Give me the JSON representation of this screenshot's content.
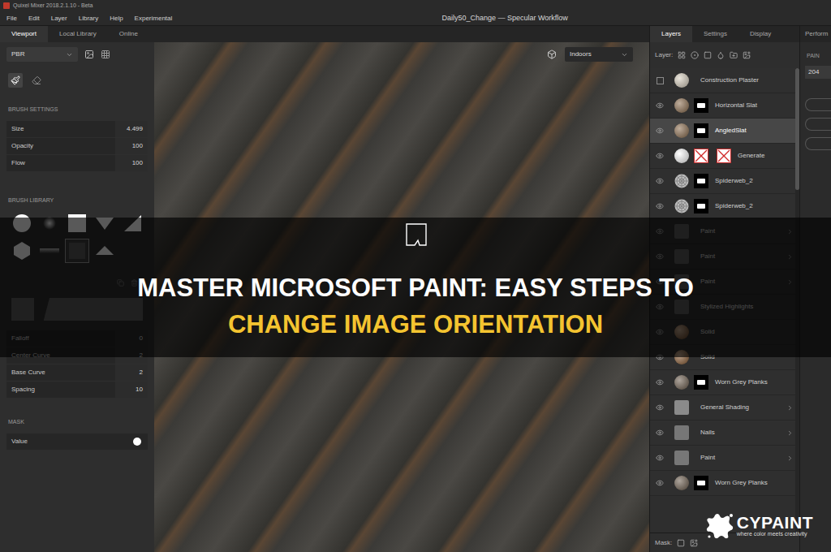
{
  "window": {
    "app_title": "Quixel Mixer 2018.2.1.10 - Beta",
    "document_title": "Daily50_Change — Specular Workflow"
  },
  "menu": [
    "File",
    "Edit",
    "Layer",
    "Library",
    "Help",
    "Experimental"
  ],
  "left_tabs": [
    {
      "label": "Viewport",
      "selected": true
    },
    {
      "label": "Local Library",
      "selected": false
    },
    {
      "label": "Online",
      "selected": false
    }
  ],
  "right_tabs": [
    {
      "label": "Layers",
      "selected": true
    },
    {
      "label": "Settings",
      "selected": false
    },
    {
      "label": "Display",
      "selected": false
    }
  ],
  "far_tab": {
    "label": "Perform",
    "selected": false
  },
  "render_mode": "PBR",
  "tools": [
    {
      "kind": "brush",
      "selected": true
    },
    {
      "kind": "eraser",
      "selected": false
    }
  ],
  "brush_settings": {
    "heading": "BRUSH SETTINGS",
    "rows": [
      {
        "label": "Size",
        "value": "4.499"
      },
      {
        "label": "Opacity",
        "value": "100"
      },
      {
        "label": "Flow",
        "value": "100"
      }
    ]
  },
  "brush_library": {
    "heading": "BRUSH LIBRARY",
    "brushes": [
      {
        "kind": "circle",
        "selected": false
      },
      {
        "kind": "soft",
        "selected": false
      },
      {
        "kind": "square",
        "selected": false
      },
      {
        "kind": "triangle-down",
        "selected": false
      },
      {
        "kind": "corner",
        "selected": false
      },
      {
        "kind": "hexagon",
        "selected": false
      },
      {
        "kind": "gradient",
        "selected": false
      },
      {
        "kind": "square",
        "selected": true
      },
      {
        "kind": "triangle-up",
        "selected": false
      }
    ]
  },
  "curve_settings": {
    "rows": [
      {
        "label": "Falloff",
        "value": "0"
      },
      {
        "label": "Center Curve",
        "value": "2"
      },
      {
        "label": "Base Curve",
        "value": "2"
      },
      {
        "label": "Spacing",
        "value": "10"
      }
    ]
  },
  "mask": {
    "heading": "MASK",
    "label": "Value",
    "on": false
  },
  "viewport": {
    "environment": "Indoors"
  },
  "layers": {
    "label": "Layer:",
    "mask_label": "Mask:",
    "items": [
      {
        "name": "Construction Plaster",
        "visible": false,
        "kind": "material",
        "color": "#d8cfbe",
        "has_mask": false,
        "expandable": false,
        "selected": false
      },
      {
        "name": "Horizontal Slat",
        "visible": true,
        "kind": "material",
        "color": "#8a6a4a",
        "has_mask": true,
        "expandable": false,
        "selected": false
      },
      {
        "name": "AngledSlat",
        "visible": true,
        "kind": "material",
        "color": "#8a6a4a",
        "has_mask": true,
        "expandable": false,
        "selected": true
      },
      {
        "name": "Generate",
        "visible": true,
        "kind": "generator",
        "color": "#ffffff",
        "has_mask": true,
        "expandable": false,
        "selected": false
      },
      {
        "name": "Spiderweb_2",
        "visible": true,
        "kind": "smart",
        "color": "#bbbbbb",
        "has_mask": true,
        "expandable": false,
        "selected": false
      },
      {
        "name": "Spiderweb_2",
        "visible": true,
        "kind": "smart",
        "color": "#bbbbbb",
        "has_mask": true,
        "expandable": false,
        "selected": false
      },
      {
        "name": "Paint",
        "visible": true,
        "kind": "group",
        "color": "#5a5a5a",
        "has_mask": false,
        "expandable": true,
        "selected": false
      },
      {
        "name": "Paint",
        "visible": true,
        "kind": "group",
        "color": "#5a5a5a",
        "has_mask": false,
        "expandable": true,
        "selected": false
      },
      {
        "name": "Paint",
        "visible": true,
        "kind": "group",
        "color": "#5a5a5a",
        "has_mask": false,
        "expandable": true,
        "selected": false
      },
      {
        "name": "Stylized Highlights",
        "visible": true,
        "kind": "group",
        "color": "#5a5a5a",
        "has_mask": false,
        "expandable": false,
        "selected": false
      },
      {
        "name": "Solid",
        "visible": true,
        "kind": "fill",
        "color": "#8a5a30",
        "has_mask": false,
        "expandable": false,
        "selected": false
      },
      {
        "name": "Solid",
        "visible": true,
        "kind": "fill",
        "color": "#8a5a30",
        "has_mask": false,
        "expandable": false,
        "selected": false
      },
      {
        "name": "Worn Grey Planks",
        "visible": true,
        "kind": "material",
        "color": "#6a5a4a",
        "has_mask": true,
        "expandable": false,
        "selected": false
      },
      {
        "name": "General Shading",
        "visible": true,
        "kind": "group",
        "color": "#8a8a8a",
        "has_mask": false,
        "expandable": true,
        "selected": false
      },
      {
        "name": "Nails",
        "visible": true,
        "kind": "group",
        "color": "#777777",
        "has_mask": false,
        "expandable": true,
        "selected": false
      },
      {
        "name": "Paint",
        "visible": true,
        "kind": "group",
        "color": "#777777",
        "has_mask": false,
        "expandable": true,
        "selected": false
      },
      {
        "name": "Worn Grey Planks",
        "visible": true,
        "kind": "material",
        "color": "#6a5a4a",
        "has_mask": true,
        "expandable": false,
        "selected": false
      }
    ]
  },
  "side_panel": {
    "heading": "PAIN",
    "value": "204"
  },
  "banner": {
    "line1": "MASTER MICROSOFT PAINT: EASY STEPS TO",
    "line2": "CHANGE IMAGE ORIENTATION"
  },
  "logo": {
    "name": "CYPAINT",
    "tagline": "where color meets creativity"
  }
}
